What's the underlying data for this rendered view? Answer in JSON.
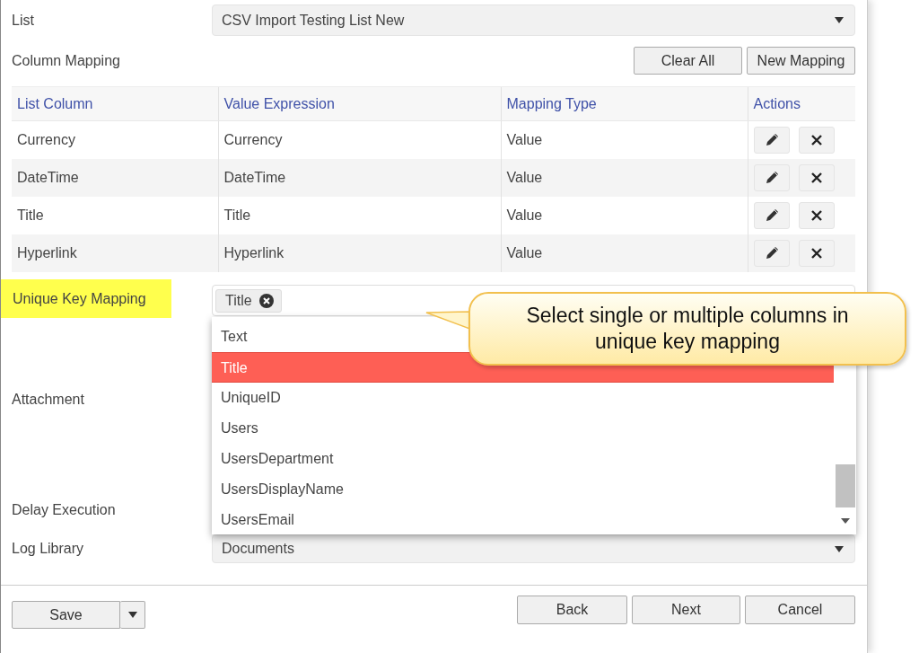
{
  "list": {
    "label": "List",
    "value": "CSV Import Testing List New"
  },
  "column_mapping": {
    "label": "Column Mapping",
    "buttons": [
      "Clear All",
      "New Mapping"
    ],
    "columns": [
      "List Column",
      "Value Expression",
      "Mapping Type",
      "Actions"
    ],
    "rows": [
      {
        "list_column": "Currency",
        "value_expression": "Currency",
        "mapping_type": "Value"
      },
      {
        "list_column": "DateTime",
        "value_expression": "DateTime",
        "mapping_type": "Value"
      },
      {
        "list_column": "Title",
        "value_expression": "Title",
        "mapping_type": "Value"
      },
      {
        "list_column": "Hyperlink",
        "value_expression": "Hyperlink",
        "mapping_type": "Value"
      }
    ]
  },
  "unique_key_mapping": {
    "label": "Unique Key Mapping",
    "highlighted": true,
    "chips": [
      "Title"
    ],
    "options": [
      {
        "label": "Text",
        "selected": false
      },
      {
        "label": "Title",
        "selected": true
      },
      {
        "label": "UniqueID",
        "selected": false
      },
      {
        "label": "Users",
        "selected": false
      },
      {
        "label": "UsersDepartment",
        "selected": false
      },
      {
        "label": "UsersDisplayName",
        "selected": false
      },
      {
        "label": "UsersEmail",
        "selected": false
      }
    ]
  },
  "attachment": {
    "label": "Attachment"
  },
  "delay_execution": {
    "label": "Delay Execution"
  },
  "log_library": {
    "label": "Log Library",
    "value": "Documents"
  },
  "callout": {
    "text": "Select single or multiple columns in unique key mapping"
  },
  "footer": {
    "save": "Save",
    "buttons": [
      "Back",
      "Next",
      "Cancel"
    ]
  }
}
